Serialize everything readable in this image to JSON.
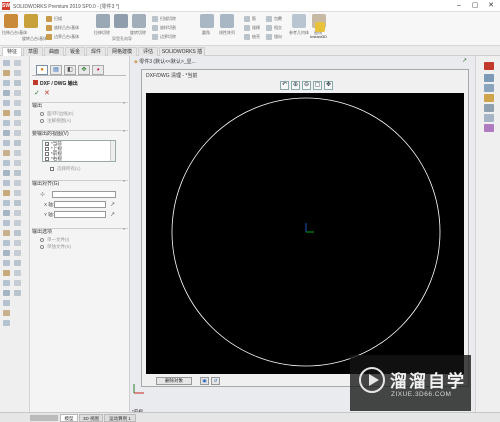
{
  "window": {
    "title": "SOLIDWORKS Premium 2019 SP0.0 - [零件3 *]",
    "logo_text": "SW"
  },
  "ribbon": {
    "tools": [
      "拉伸凸台/基体",
      "旋转凸台/基体",
      "扫描",
      "放样凸台/基体",
      "边界凸台/基体",
      "拉伸切除",
      "异型孔向导",
      "旋转切除",
      "扫描切除",
      "放样切割",
      "边界切除",
      "圆角",
      "线性阵列",
      "筋",
      "拔模",
      "抽壳",
      "包覆",
      "相交",
      "镜向",
      "参考几何体",
      "曲线",
      "Instant3D"
    ],
    "instant3d_label": "Instant3D"
  },
  "command_tabs": [
    "特征",
    "草图",
    "曲面",
    "钣金",
    "焊件",
    "网格建模",
    "评估",
    "SOLIDWORKS 插件"
  ],
  "property_manager": {
    "title": "DXF / DWG 输出",
    "ok_symbol": "✓",
    "cancel_symbol": "✕",
    "output_section": {
      "label": "输出",
      "options": [
        "面/环/边线(E)",
        "注解视图(A)"
      ]
    },
    "views_section": {
      "label": "要输出的视图(V)",
      "items": [
        {
          "label": "*当前",
          "checked": true
        },
        {
          "label": "*上视",
          "checked": false
        },
        {
          "label": "*前视",
          "checked": false
        },
        {
          "label": "*右视",
          "checked": false
        }
      ],
      "select_all_label": "选择所有(L)"
    },
    "coord_section": {
      "label": "输出对齐(G)",
      "x_label": "X 轴:",
      "y_label": "Y 轴:"
    },
    "file_section": {
      "label": "输出选项",
      "options": [
        "单一文件(I)",
        "单独文件(S)"
      ]
    }
  },
  "model_area": {
    "breadcrumb": "零件3 (默认<<默认>_显..."
  },
  "preview_dialog": {
    "title": "DXF/DWG 清理 - *当前",
    "tools": [
      "↶",
      "⊕",
      "⊖",
      "▢",
      "✥"
    ],
    "delete_button": "删除对象"
  },
  "status_tabs": [
    "模型",
    "3D 视图",
    "运动算例 1"
  ],
  "view_label": "*前视",
  "watermark": {
    "title": "溜溜自学",
    "url": "ZIXUE.3D66.COM"
  },
  "colors": {
    "accent": "#1a5fb4",
    "canvas_bg": "#000000",
    "circle": "#ffffff",
    "triad_x": "#00c000",
    "triad_y": "#1e5bd8"
  }
}
